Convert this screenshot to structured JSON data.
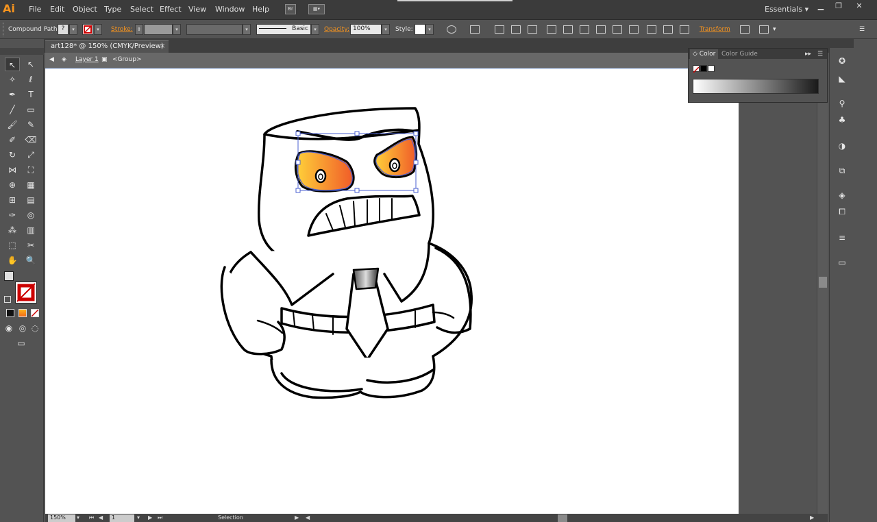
{
  "app": {
    "logo": "Ai",
    "menu": [
      "File",
      "Edit",
      "Object",
      "Type",
      "Select",
      "Effect",
      "View",
      "Window",
      "Help"
    ],
    "bridge_label": "Br",
    "workspace": "Essentials",
    "workspace_arrow": "▾"
  },
  "control_bar": {
    "selection_type": "Compound Path",
    "fill_dd": "?",
    "stroke_label": "Stroke:",
    "brush_label": "Basic",
    "opacity_label": "Opacity:",
    "opacity_value": "100%",
    "style_label": "Style:",
    "transform_label": "Transform"
  },
  "document": {
    "tab_title": "art128* @ 150% (CMYK/Preview)",
    "tab_close": "×",
    "breadcrumb_layer": "Layer 1",
    "breadcrumb_group": "<Group>"
  },
  "status_bar": {
    "zoom": "150%",
    "page": "1",
    "tool": "Selection"
  },
  "color_panel": {
    "tab_color": "Color",
    "tab_color_guide": "Color Guide"
  },
  "colors": {
    "accent_orange": "#f7941e",
    "eye_gradient_start": "#ffd23a",
    "eye_gradient_end": "#f05a28",
    "selection_blue": "#4a5fd0"
  },
  "icons": {
    "tools": [
      "selection-tool-icon",
      "direct-selection-tool-icon",
      "magic-wand-icon",
      "lasso-icon",
      "pen-icon",
      "type-icon",
      "line-icon",
      "rectangle-icon",
      "paintbrush-icon",
      "pencil-icon",
      "blob-brush-icon",
      "eraser-icon",
      "rotate-icon",
      "scale-icon",
      "width-icon",
      "free-transform-icon",
      "shape-builder-icon",
      "perspective-grid-icon",
      "mesh-icon",
      "gradient-icon",
      "eyedropper-icon",
      "blend-icon",
      "symbol-sprayer-icon",
      "column-graph-icon",
      "artboard-icon",
      "slice-icon",
      "hand-icon",
      "zoom-icon"
    ],
    "dock": [
      "appearance-icon",
      "brushes-icon",
      "color-icon",
      "symbols-icon",
      "graphic-styles-icon",
      "transform-icon",
      "layers-icon",
      "artboards-icon",
      "stroke-icon",
      "gradient-panel-icon"
    ]
  }
}
